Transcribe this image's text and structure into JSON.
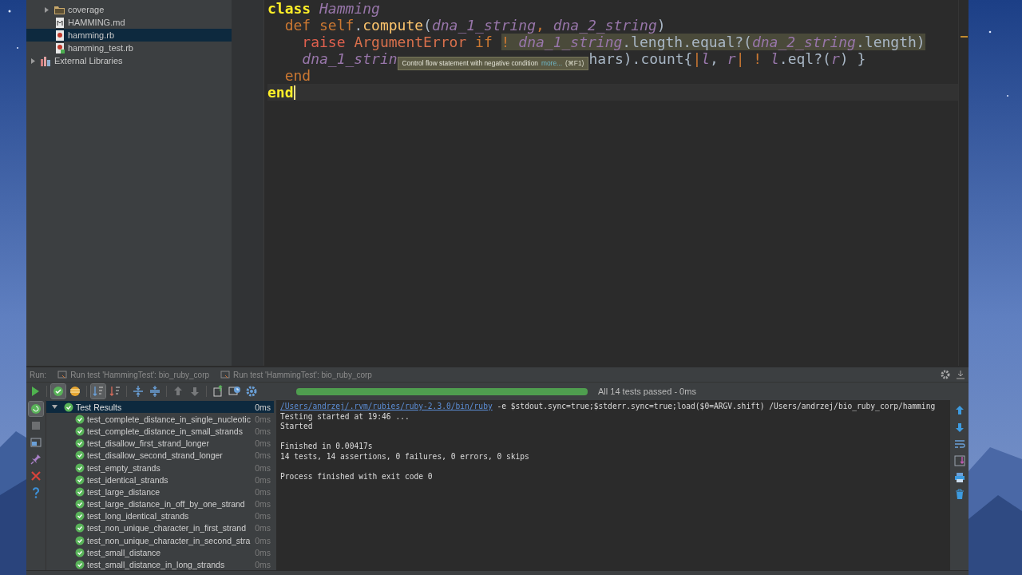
{
  "project_tree": [
    {
      "children": [
        {
          "label": "coverage",
          "kind": "folder",
          "expanded": false,
          "selected": false
        },
        {
          "label": "HAMMING.md",
          "kind": "markdown",
          "selected": false
        },
        {
          "label": "hamming.rb",
          "kind": "ruby",
          "selected": true
        },
        {
          "label": "hamming_test.rb",
          "kind": "ruby-test",
          "selected": false
        }
      ]
    },
    {
      "label": "External Libraries",
      "kind": "library",
      "expanded": false,
      "selected": false
    }
  ],
  "editor": {
    "lines": [
      {
        "current": false,
        "tokens": [
          {
            "text": "class ",
            "kind": "kw",
            "matched": true
          },
          {
            "text": "Hamming",
            "kind": "param"
          }
        ],
        "children": [
          {
            "current": false,
            "tokens": [
              {
                "text": "def ",
                "kind": "kw"
              },
              {
                "text": "self",
                "kind": "kw"
              },
              {
                "text": ".",
                "kind": "plain"
              },
              {
                "text": "compute",
                "kind": "method"
              },
              {
                "text": "(",
                "kind": "plain"
              },
              {
                "text": "dna_1_string",
                "kind": "param"
              },
              {
                "text": ", ",
                "kind": "kw"
              },
              {
                "text": "dna_2_string",
                "kind": "param"
              },
              {
                "text": ")",
                "kind": "plain"
              }
            ],
            "children": [
              {
                "current": false,
                "tokens": [
                  {
                    "text": "raise ",
                    "kind": "call"
                  },
                  {
                    "text": "ArgumentError ",
                    "kind": "const"
                  },
                  {
                    "text": "if ",
                    "kind": "kw"
                  },
                  {
                    "text": "! ",
                    "kind": "kw",
                    "warn": true
                  },
                  {
                    "text": "dna_1_string",
                    "kind": "param",
                    "warn": true
                  },
                  {
                    "text": ".length.equal?(",
                    "kind": "plain",
                    "warn": true
                  },
                  {
                    "text": "dna_2_string",
                    "kind": "param",
                    "warn": true
                  },
                  {
                    "text": ".length)",
                    "kind": "plain",
                    "warn": true
                  }
                ]
              },
              {
                "current": false,
                "tokens": [
                  {
                    "text": "dna_1_strin",
                    "kind": "param"
                  }
                ],
                "tooltip": {
                  "text": "Control flow statement with negative condition",
                  "link": "more...",
                  "shortcut": "(⌘F1)"
                },
                "tokens_after": [
                  {
                    "text": "hars).count{",
                    "kind": "plain"
                  },
                  {
                    "text": "|",
                    "kind": "kw"
                  },
                  {
                    "text": "l",
                    "kind": "param"
                  },
                  {
                    "text": ", ",
                    "kind": "plain"
                  },
                  {
                    "text": "r",
                    "kind": "param"
                  },
                  {
                    "text": "| ",
                    "kind": "kw"
                  },
                  {
                    "text": "! ",
                    "kind": "kw"
                  },
                  {
                    "text": "l",
                    "kind": "param"
                  },
                  {
                    "text": ".eql?(",
                    "kind": "plain"
                  },
                  {
                    "text": "r",
                    "kind": "param"
                  },
                  {
                    "text": ") }",
                    "kind": "plain"
                  }
                ]
              }
            ]
          },
          {
            "current": false,
            "tokens": [
              {
                "text": "end",
                "kind": "kw"
              }
            ]
          }
        ]
      },
      {
        "current": true,
        "tokens": [
          {
            "text": "end",
            "kind": "kw",
            "matched": true
          }
        ]
      }
    ]
  },
  "run": {
    "label": "Run:",
    "tabs": [
      {
        "title": "Run test 'HammingTest': bio_ruby_corp"
      },
      {
        "title": "Run test 'HammingTest': bio_ruby_corp"
      }
    ],
    "toolbar": [
      {
        "kind": "run"
      },
      {
        "kind": "show-passed",
        "pressed": true
      },
      {
        "kind": "show-ignored",
        "pressed": false
      },
      {
        "kind": "sort-alpha",
        "pressed": true
      },
      {
        "kind": "sort-duration",
        "pressed": false
      },
      {
        "kind": "expand-all"
      },
      {
        "kind": "collapse-all"
      },
      {
        "kind": "previous"
      },
      {
        "kind": "next"
      },
      {
        "kind": "export"
      },
      {
        "kind": "history"
      },
      {
        "kind": "settings"
      }
    ],
    "progress": {
      "level": 1,
      "status": "All 14 tests passed - 0ms"
    },
    "side_tools": [
      {
        "kind": "rerun",
        "pressed": true
      },
      {
        "kind": "stop"
      },
      {
        "kind": "layout"
      },
      {
        "kind": "pin"
      },
      {
        "kind": "close"
      },
      {
        "kind": "help"
      }
    ],
    "results": {
      "label": "Test Results",
      "duration": "0ms",
      "expanded": true,
      "selected": true,
      "passed": true,
      "children": [
        {
          "label": "test_complete_distance_in_single_nucleotic",
          "duration": "0ms",
          "passed": true
        },
        {
          "label": "test_complete_distance_in_small_strands",
          "duration": "0ms",
          "passed": true
        },
        {
          "label": "test_disallow_first_strand_longer",
          "duration": "0ms",
          "passed": true
        },
        {
          "label": "test_disallow_second_strand_longer",
          "duration": "0ms",
          "passed": true
        },
        {
          "label": "test_empty_strands",
          "duration": "0ms",
          "passed": true
        },
        {
          "label": "test_identical_strands",
          "duration": "0ms",
          "passed": true
        },
        {
          "label": "test_large_distance",
          "duration": "0ms",
          "passed": true
        },
        {
          "label": "test_large_distance_in_off_by_one_strand",
          "duration": "0ms",
          "passed": true
        },
        {
          "label": "test_long_identical_strands",
          "duration": "0ms",
          "passed": true
        },
        {
          "label": "test_non_unique_character_in_first_strand",
          "duration": "0ms",
          "passed": true
        },
        {
          "label": "test_non_unique_character_in_second_stra",
          "duration": "0ms",
          "passed": true
        },
        {
          "label": "test_small_distance",
          "duration": "0ms",
          "passed": true
        },
        {
          "label": "test_small_distance_in_long_strands",
          "duration": "0ms",
          "passed": true
        }
      ]
    },
    "console": {
      "blocks": [
        [
          {
            "link": "/Users/andrzej/.rvm/rubies/ruby-2.3.0/bin/ruby",
            "text": " -e $stdout.sync=true;$stderr.sync=true;load($0=ARGV.shift) /Users/andrzej/bio_ruby_corp/hamming"
          },
          {
            "text": "Testing started at 19:46 ..."
          },
          {
            "text": "Started"
          }
        ],
        [
          {
            "text": "Finished in 0.00417s"
          },
          {
            "text": "14 tests, 14 assertions, 0 failures, 0 errors, 0 skips"
          }
        ],
        [
          {
            "text": "Process finished with exit code 0"
          }
        ]
      ]
    },
    "console_tools": [
      {
        "kind": "up"
      },
      {
        "kind": "down"
      },
      {
        "kind": "wrap"
      },
      {
        "kind": "scroll-end"
      },
      {
        "kind": "print"
      },
      {
        "kind": "trash"
      }
    ]
  }
}
